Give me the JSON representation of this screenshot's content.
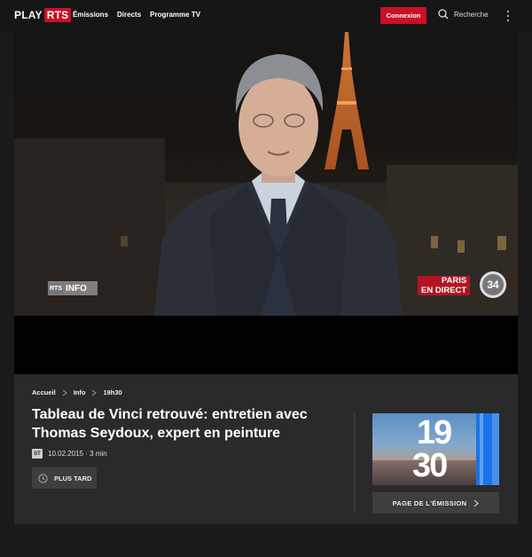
{
  "header": {
    "logo_play": "PLAY",
    "logo_rts": "RTS",
    "nav": [
      "Émissions",
      "Directs",
      "Programme TV"
    ],
    "login_label": "Connexion",
    "search_label": "Recherche"
  },
  "player": {
    "bug_left_prefix": "RTS",
    "bug_left": "INFO",
    "live_line1": "PARIS",
    "live_line2": "EN DIRECT",
    "channel_number": "34"
  },
  "breadcrumb": [
    "Accueil",
    "Info",
    "19h30"
  ],
  "video": {
    "title": "Tableau de Vinci retrouvé: entretien avec Thomas Seydoux, expert en peinture",
    "badge": "ST",
    "date": "10.02.2015",
    "duration": "3 min",
    "later_label": "PLUS TARD"
  },
  "show": {
    "thumb_top": "19",
    "thumb_bottom": "30",
    "page_label": "PAGE DE L'ÉMISSION"
  },
  "colors": {
    "brand_red": "#c91024",
    "accent_blue": "#1a73e8"
  }
}
